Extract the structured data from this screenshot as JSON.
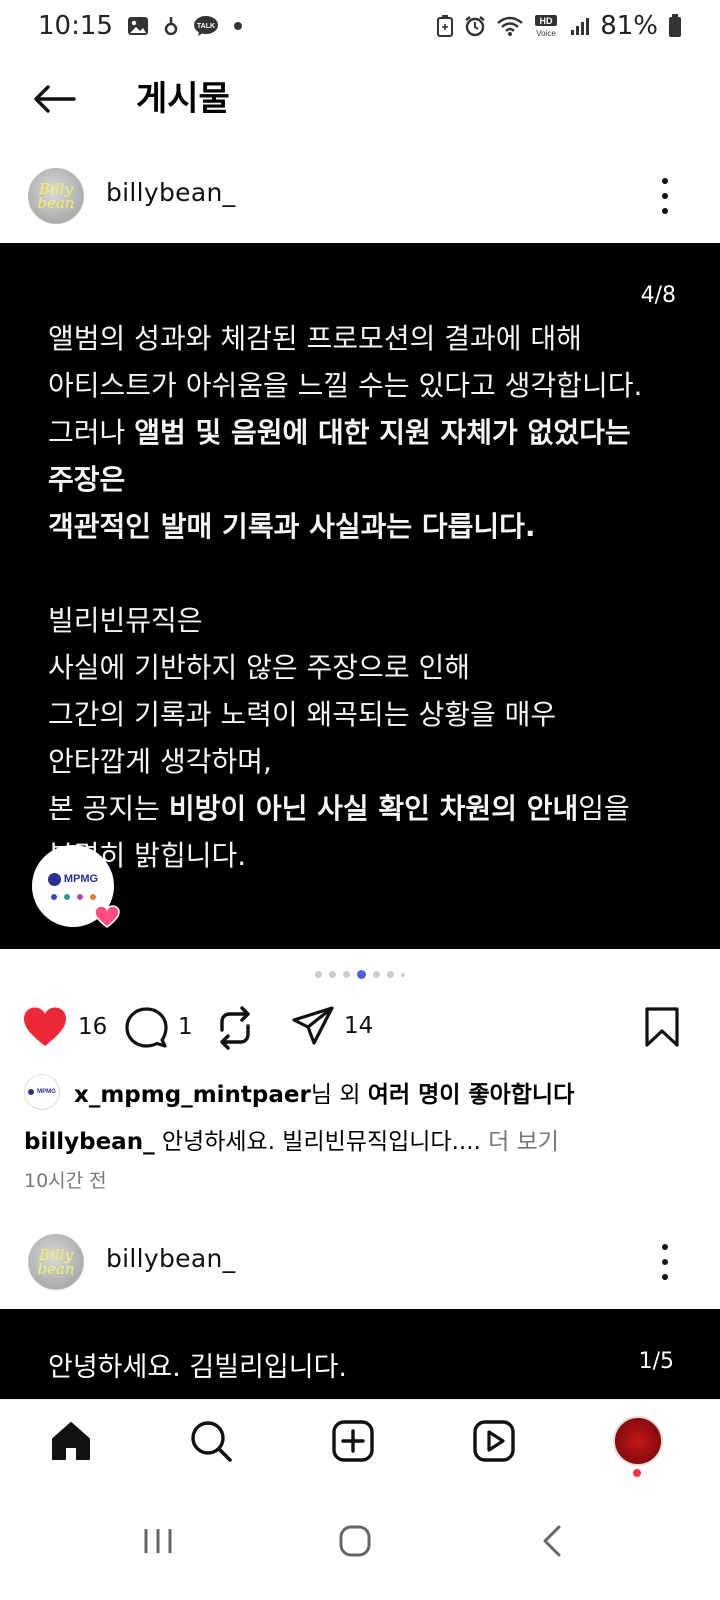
{
  "status_bar": {
    "time": "10:15",
    "battery": "81%",
    "talk_label": "TALK",
    "hd_label": "HD",
    "voice_label": "Voice"
  },
  "header": {
    "title": "게시물"
  },
  "post": {
    "username": "billybean_",
    "avatar_text_1": "Billy",
    "avatar_text_2": "bean",
    "slide_counter": "4/8",
    "lines": [
      "앨범의 성과와 체감된 프로모션의 결과에 대해",
      "아티스트가 아쉬움을 느낄 수는 있다고 생각합니다.",
      "그러나 ",
      "앨범 및 음원에 대한 지원 자체가 없었다는",
      "주장은",
      "객관적인 발매 기록과 사실과는 다릅니다.",
      "빌리빈뮤직은",
      "사실에 기반하지 않은 주장으로 인해",
      "그간의 기록과 노력이 왜곡되는 상황을 매우",
      "안타깝게 생각하며,",
      "본 공지는 ",
      "비방이 아닌 사실 확인 차원의 안내",
      "임을",
      "분명히 밝힙니다."
    ],
    "brand_badge_text": "MPMG",
    "likes_count": "16",
    "comments_count": "1",
    "shares_count": "14",
    "liked_by_user": "x_mpmg_mintpaer",
    "liked_by_suffix_1": "님 외 ",
    "liked_by_suffix_2": "여러 명이 좋아합니다",
    "caption_user": "billybean_",
    "caption_text": " 안녕하세요. 빌리빈뮤직입니다.... ",
    "caption_more": "더 보기",
    "time_ago": "10시간 전"
  },
  "second_post": {
    "username": "billybean_",
    "avatar_text_1": "Billy",
    "avatar_text_2": "bean",
    "text": "안녕하세요. 김빌리입니다.",
    "slide_counter": "1/5"
  },
  "colors": {
    "like_red": "#ed2939",
    "accent_blue": "#4a63d9",
    "notification_red": "#ff3040"
  },
  "icons": {
    "nav": [
      "home-icon",
      "search-icon",
      "create-icon",
      "reels-icon",
      "profile-avatar"
    ],
    "actions": [
      "heart-icon",
      "comment-icon",
      "repost-icon",
      "share-icon",
      "bookmark-icon"
    ]
  }
}
